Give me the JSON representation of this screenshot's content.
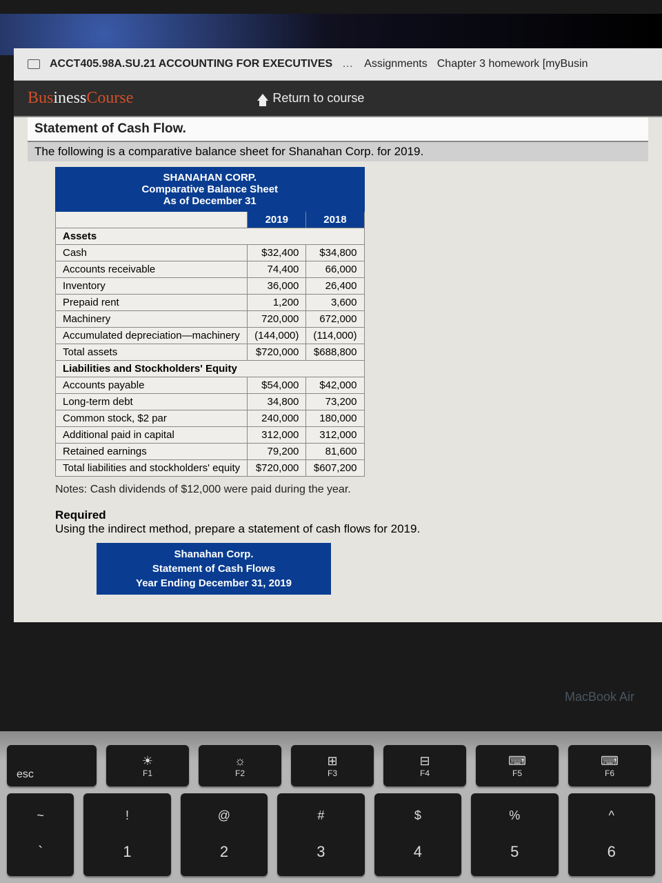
{
  "breadcrumb": {
    "course": "ACCT405.98A.SU.21 ACCOUNTING FOR EXECUTIVES",
    "dots": "…",
    "assignments": "Assignments",
    "current": "Chapter 3 homework [myBusin"
  },
  "brand": {
    "b1": "Bus",
    "mid": "iness",
    "b2": "Course"
  },
  "return_label": "Return to course",
  "section_title": "Statement of Cash Flow.",
  "intro": "The following is a comparative balance sheet for Shanahan Corp. for 2019.",
  "sheet_header": {
    "l1": "SHANAHAN CORP.",
    "l2": "Comparative Balance Sheet",
    "l3": "As of December 31"
  },
  "years": {
    "y1": "2019",
    "y2": "2018"
  },
  "rows": {
    "assets_label": "Assets",
    "cash": {
      "label": "Cash",
      "y1": "$32,400",
      "y2": "$34,800"
    },
    "ar": {
      "label": "Accounts receivable",
      "y1": "74,400",
      "y2": "66,000"
    },
    "inv": {
      "label": "Inventory",
      "y1": "36,000",
      "y2": "26,400"
    },
    "prepaid": {
      "label": "Prepaid rent",
      "y1": "1,200",
      "y2": "3,600"
    },
    "mach": {
      "label": "Machinery",
      "y1": "720,000",
      "y2": "672,000"
    },
    "accdep": {
      "label": "Accumulated depreciation—machinery",
      "y1": "(144,000)",
      "y2": "(114,000)"
    },
    "totassets": {
      "label": "Total assets",
      "y1": "$720,000",
      "y2": "$688,800"
    },
    "liab_label": "Liabilities and Stockholders' Equity",
    "ap": {
      "label": "Accounts payable",
      "y1": "$54,000",
      "y2": "$42,000"
    },
    "ltd": {
      "label": "Long-term debt",
      "y1": "34,800",
      "y2": "73,200"
    },
    "cs": {
      "label": "Common stock, $2 par",
      "y1": "240,000",
      "y2": "180,000"
    },
    "apic": {
      "label": "Additional paid in capital",
      "y1": "312,000",
      "y2": "312,000"
    },
    "re": {
      "label": "Retained earnings",
      "y1": "79,200",
      "y2": "81,600"
    },
    "totliab": {
      "label": "Total liabilities and stockholders' equity",
      "y1": "$720,000",
      "y2": "$607,200"
    }
  },
  "notes": "Notes: Cash dividends of $12,000 were paid during the year.",
  "required": {
    "heading": "Required",
    "text": "Using the indirect method, prepare a statement of cash flows for 2019."
  },
  "answer_header": {
    "l1": "Shanahan Corp.",
    "l2": "Statement of Cash Flows",
    "l3": "Year Ending December 31, 2019"
  },
  "mba": "MacBook Air",
  "keys": {
    "esc": "esc",
    "f1": "F1",
    "f2": "F2",
    "f3": "F3",
    "f4": "F4",
    "f5": "F5",
    "f6": "F6",
    "tilde_top": "~",
    "tilde_bot": "`",
    "k1t": "!",
    "k1b": "1",
    "k2t": "@",
    "k2b": "2",
    "k3t": "#",
    "k3b": "3",
    "k4t": "$",
    "k4b": "4",
    "k5t": "%",
    "k5b": "5",
    "k6t": "^",
    "k6b": "6"
  },
  "icons": {
    "bright_down": "☀",
    "bright_up": "☼",
    "mission": "⊞",
    "launch": "⊟",
    "kb_down": "⌨",
    "kb_up": "⌨"
  }
}
